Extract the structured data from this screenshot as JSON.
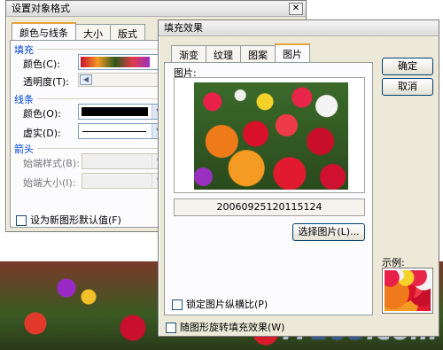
{
  "watermark": {
    "text_a": "IT",
    "text_b": "168",
    "text_c": ".com"
  },
  "format_dialog": {
    "title": "设置对象格式",
    "tabs": [
      "颜色与线条",
      "大小",
      "版式"
    ],
    "fill_section": "填充",
    "fill_color_label": "颜色(C):",
    "transparency_label": "透明度(T):",
    "line_section": "线条",
    "line_color_label": "颜色(O):",
    "line_dash_label": "虚实(D):",
    "arrow_section": "箭头",
    "begin_style_label": "始端样式(B):",
    "begin_size_label": "始端大小(I):",
    "default_checkbox": "设为新图形默认值(F)"
  },
  "fill_dialog": {
    "title": "填充效果",
    "tabs": [
      "渐变",
      "纹理",
      "图案",
      "图片"
    ],
    "active_tab": "图片",
    "picture_label": "图片:",
    "picture_name": "20060925120115124",
    "select_picture_button": "选择图片(L)...",
    "ok_button": "确定",
    "cancel_button": "取消",
    "sample_label": "示例:",
    "lock_aspect_checkbox": "锁定图片纵横比(P)",
    "rotate_checkbox": "随图形旋转填充效果(W)"
  }
}
